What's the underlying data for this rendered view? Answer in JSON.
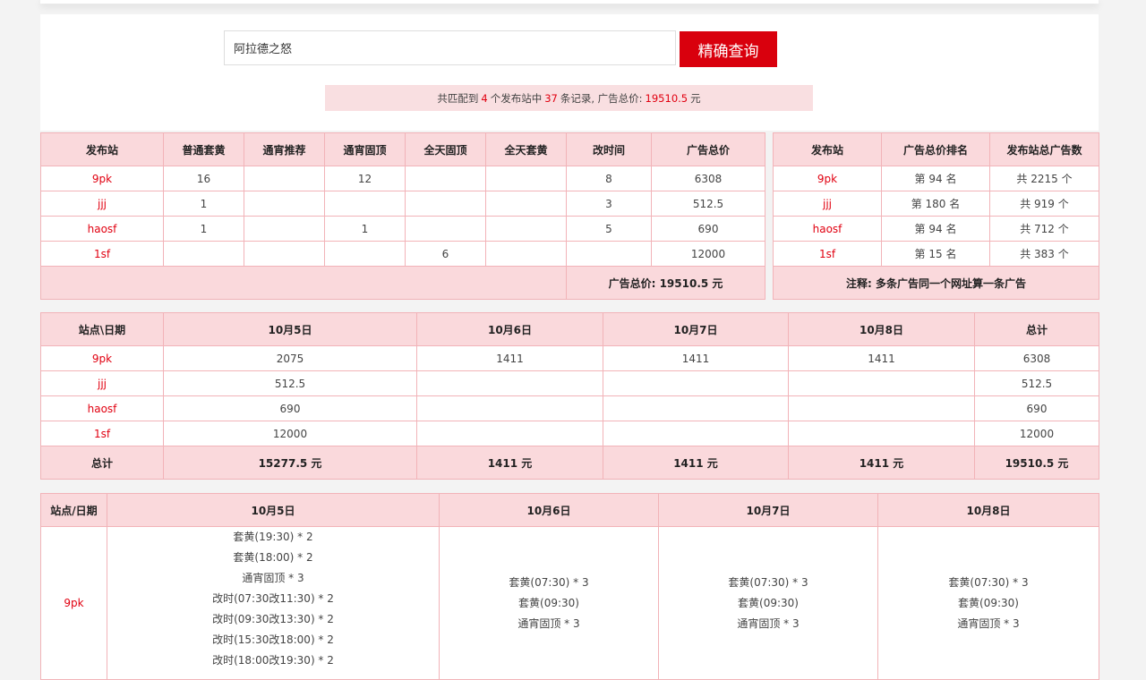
{
  "search": {
    "value": "阿拉德之怒",
    "button_label": "精确查询"
  },
  "summary": {
    "prefix": "共匹配到",
    "sites_count": "4",
    "mid1": "个发布站中",
    "records_count": "37",
    "mid2": "条记录, 广告总价:",
    "total_price": "19510.5",
    "suffix": "元"
  },
  "table1": {
    "headers": [
      "发布站",
      "普通套黄",
      "通宵推荐",
      "通宵固顶",
      "全天固顶",
      "全天套黄",
      "改时间",
      "广告总价"
    ],
    "rows": [
      [
        "9pk",
        "16",
        "",
        "12",
        "",
        "",
        "8",
        "6308"
      ],
      [
        "jjj",
        "1",
        "",
        "",
        "",
        "",
        "3",
        "512.5"
      ],
      [
        "haosf",
        "1",
        "",
        "1",
        "",
        "",
        "5",
        "690"
      ],
      [
        "1sf",
        "",
        "",
        "",
        "6",
        "",
        "",
        "12000"
      ]
    ],
    "footer": "广告总价: 19510.5 元"
  },
  "table2": {
    "headers": [
      "发布站",
      "广告总价排名",
      "发布站总广告数"
    ],
    "rows": [
      [
        "9pk",
        "第 94 名",
        "共 2215 个"
      ],
      [
        "jjj",
        "第 180 名",
        "共 919 个"
      ],
      [
        "haosf",
        "第 94 名",
        "共 712 个"
      ],
      [
        "1sf",
        "第 15 名",
        "共 383 个"
      ]
    ],
    "footer": "注释: 多条广告同一个网址算一条广告"
  },
  "table3": {
    "headers": [
      "站点\\日期",
      "10月5日",
      "10月6日",
      "10月7日",
      "10月8日",
      "总计"
    ],
    "rows": [
      [
        "9pk",
        "2075",
        "1411",
        "1411",
        "1411",
        "6308"
      ],
      [
        "jjj",
        "512.5",
        "",
        "",
        "",
        "512.5"
      ],
      [
        "haosf",
        "690",
        "",
        "",
        "",
        "690"
      ],
      [
        "1sf",
        "12000",
        "",
        "",
        "",
        "12000"
      ]
    ],
    "footer": [
      "总计",
      "15277.5 元",
      "1411 元",
      "1411 元",
      "1411 元",
      "19510.5 元"
    ]
  },
  "table4": {
    "headers": [
      "站点/日期",
      "10月5日",
      "10月6日",
      "10月7日",
      "10月8日"
    ],
    "row": {
      "site": "9pk",
      "d1": [
        "套黄(19:30) * 2",
        "套黄(18:00) * 2",
        "通宵固顶 * 3",
        "改时(07:30改11:30) * 2",
        "改时(09:30改13:30) * 2",
        "改时(15:30改18:00) * 2",
        "改时(18:00改19:30) * 2"
      ],
      "d2": [
        "套黄(07:30) * 3",
        "套黄(09:30)",
        "通宵固顶 * 3"
      ],
      "d3": [
        "套黄(07:30) * 3",
        "套黄(09:30)",
        "通宵固顶 * 3"
      ],
      "d4": [
        "套黄(07:30) * 3",
        "套黄(09:30)",
        "通宵固顶 * 3"
      ]
    }
  },
  "colors": {
    "accent": "#d9000d",
    "highlight_text": "#e10010",
    "header_bg": "#fad9dc",
    "border": "#f2b3b8"
  }
}
